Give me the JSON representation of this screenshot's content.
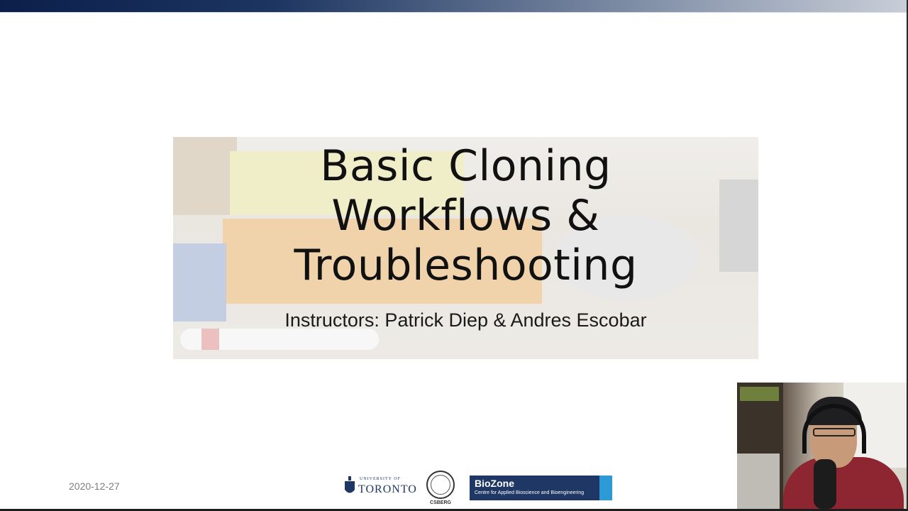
{
  "slide": {
    "title": "Basic Cloning\nWorkflows &\nTroubleshooting",
    "instructors": "Instructors: Patrick Diep & Andres Escobar",
    "date": "2020-12-27"
  },
  "logos": {
    "uoft_small": "UNIVERSITY OF",
    "uoft_big": "TORONTO",
    "csberg": "CSBERG",
    "biozone_name": "BioZone",
    "biozone_sub": "Centre for Applied Bioscience and Bioengineering"
  },
  "colors": {
    "top_bar": "#0b1f4a",
    "uoft_blue": "#1e3765",
    "biozone_accent": "#2c9ad6"
  }
}
